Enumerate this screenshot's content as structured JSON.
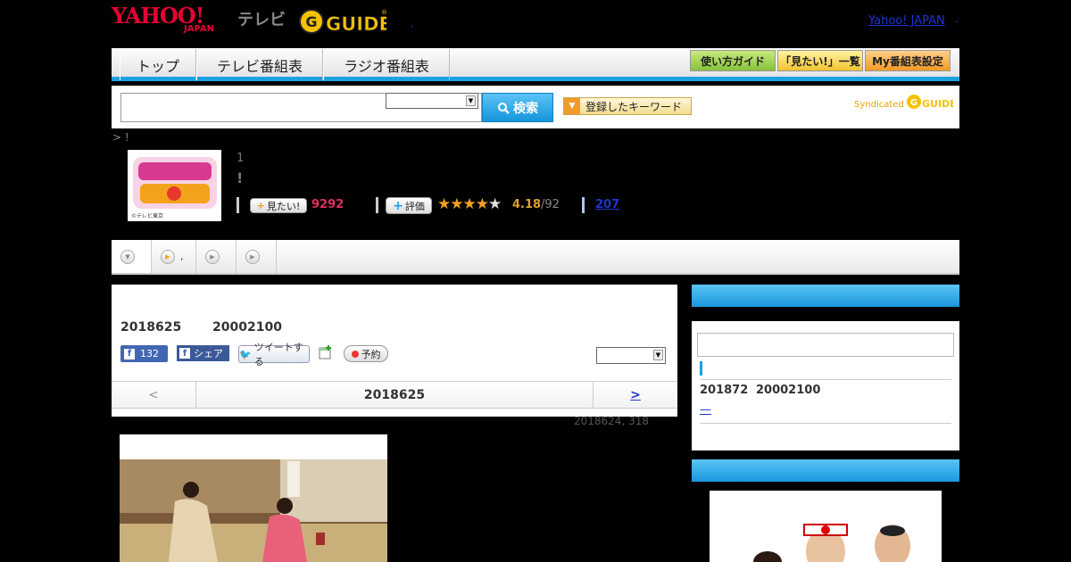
{
  "header": {
    "logo_yahoo": "YAHOO!",
    "logo_japan": "JAPAN",
    "logo_tv": "テレビ",
    "logo_gguide": "G GUIDE",
    "yahoo_japan_link": "Yahoo! JAPAN",
    "trailing_dot": ".",
    "small_dot": ","
  },
  "nav": {
    "tabs": [
      "トップ",
      "テレビ番組表",
      "ラジオ番組表"
    ],
    "buttons": [
      "使い方ガイド",
      "「見たい!」一覧",
      "My番組表設定"
    ]
  },
  "search": {
    "button_label": "検索",
    "keyword_button": "登録したキーワード",
    "syndicated": "Syndicated"
  },
  "breadcrumb": "> !",
  "program": {
    "thumb_credit": "©テレビ東京",
    "number": "1",
    "title_mark": "!",
    "mitai_label": "見たい!",
    "mitai_count": "9292",
    "hyoka_label": "評価",
    "rating": 4.18,
    "rating_text": "4.18",
    "rating_total": "/92",
    "review_count": "207"
  },
  "tabs": {
    "second_label": ","
  },
  "episode": {
    "date": "2018625",
    "time": "20002100",
    "fb_like_count": "132",
    "fb_share": "シェア",
    "tweet": "ツイートする",
    "reserve": "予約",
    "pager_prev": "<",
    "pager_date": "2018625",
    "pager_next": ">",
    "update_note": "2018624, 318"
  },
  "sidebar": {
    "next_date": "201872",
    "next_time": "20002100",
    "link": "—"
  },
  "colors": {
    "accent_blue": "#1ca1e1",
    "yahoo_red": "#e60033",
    "link_blue": "#1d35d1",
    "mitai_pink": "#e03060",
    "star_orange": "#f0a020"
  }
}
